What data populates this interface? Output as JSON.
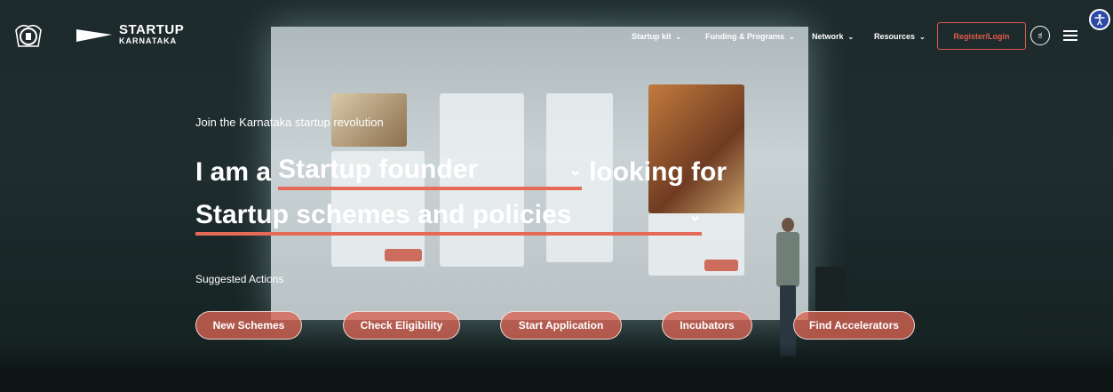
{
  "header": {
    "brand_line1": "STARTUP",
    "brand_line2": "KARNATAKA",
    "nav": [
      {
        "label": "Startup kit"
      },
      {
        "label": "Funding & Programs"
      },
      {
        "label": "Network"
      },
      {
        "label": "Resources"
      }
    ],
    "register_label": "Register/Login",
    "lang_label": "ಕ"
  },
  "hero": {
    "kicker": "Join the Karnataka startup revolution",
    "prefix": "I am a",
    "role_value": "Startup founder",
    "middle": "looking for",
    "need_value": "Startup schemes and policies",
    "suggested_label": "Suggested Actions",
    "actions": [
      {
        "label": "New Schemes"
      },
      {
        "label": "Check Eligibility"
      },
      {
        "label": "Start Application"
      },
      {
        "label": "Incubators"
      },
      {
        "label": "Find Accelerators"
      }
    ]
  },
  "colors": {
    "accent": "#e35a4a",
    "button_fill": "#d86453",
    "accessibility_bg": "#2a4aa5"
  },
  "icons": [
    "emblem-icon",
    "chevron-down-icon",
    "menu-icon",
    "accessibility-icon"
  ]
}
